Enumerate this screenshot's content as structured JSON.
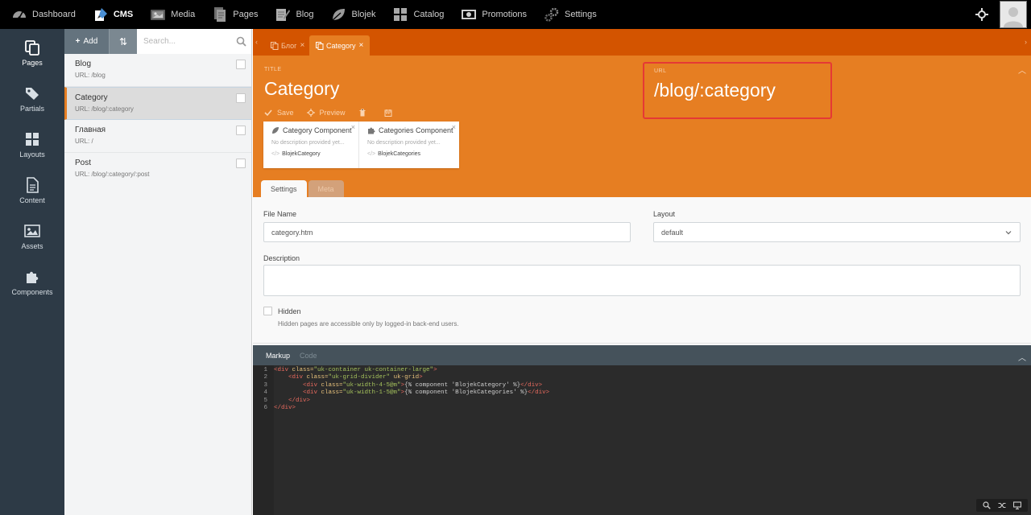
{
  "topnav": {
    "items": [
      {
        "label": "Dashboard",
        "icon": "dashboard-icon",
        "active": false
      },
      {
        "label": "CMS",
        "icon": "cms-icon",
        "active": true
      },
      {
        "label": "Media",
        "icon": "media-icon",
        "active": false
      },
      {
        "label": "Pages",
        "icon": "pages-icon",
        "active": false
      },
      {
        "label": "Blog",
        "icon": "blog-icon",
        "active": false
      },
      {
        "label": "Blojek",
        "icon": "blojek-leaf-icon",
        "active": false
      },
      {
        "label": "Catalog",
        "icon": "catalog-icon",
        "active": false
      },
      {
        "label": "Promotions",
        "icon": "promotions-icon",
        "active": false
      },
      {
        "label": "Settings",
        "icon": "settings-icon",
        "active": false
      }
    ]
  },
  "sidenav": {
    "items": [
      {
        "label": "Pages",
        "icon": "pages-icon",
        "active": true
      },
      {
        "label": "Partials",
        "icon": "tags-icon",
        "active": false
      },
      {
        "label": "Layouts",
        "icon": "layouts-icon",
        "active": false
      },
      {
        "label": "Content",
        "icon": "content-file-icon",
        "active": false
      },
      {
        "label": "Assets",
        "icon": "image-icon",
        "active": false
      },
      {
        "label": "Components",
        "icon": "puzzle-icon",
        "active": false
      }
    ]
  },
  "list": {
    "add_label": "Add",
    "sort_symbol": "⇅",
    "search_placeholder": "Search...",
    "items": [
      {
        "title": "Blog",
        "url": "URL: /blog",
        "selected": false
      },
      {
        "title": "Category",
        "url": "URL: /blog/:category",
        "selected": true
      },
      {
        "title": "Главная",
        "url": "URL: /",
        "selected": false
      },
      {
        "title": "Post",
        "url": "URL: /blog/:category/:post",
        "selected": false
      }
    ]
  },
  "editor": {
    "tabs": [
      {
        "label": "Блог",
        "active": false
      },
      {
        "label": "Category",
        "active": true
      }
    ],
    "title_label": "TITLE",
    "title": "Category",
    "url_label": "URL",
    "url": "/blog/:category",
    "actions": {
      "save": "Save",
      "preview": "Preview"
    },
    "components": [
      {
        "name": "Category Component",
        "desc": "No description provided yet...",
        "alias": "BlojekCategory",
        "icon": "leaf-icon"
      },
      {
        "name": "Categories Component",
        "desc": "No description provided yet...",
        "alias": "BlojekCategories",
        "icon": "puzzle-icon"
      }
    ],
    "subtabs": [
      {
        "label": "Settings",
        "active": true
      },
      {
        "label": "Meta",
        "active": false
      }
    ],
    "settings": {
      "file_name_label": "File Name",
      "file_name": "category.htm",
      "layout_label": "Layout",
      "layout": "default",
      "description_label": "Description",
      "description": "",
      "hidden_label": "Hidden",
      "hidden_help": "Hidden pages are accessible only by logged-in back-end users."
    },
    "code_tabs": [
      {
        "label": "Markup",
        "active": true
      },
      {
        "label": "Code",
        "active": false
      }
    ],
    "code_line_numbers": [
      "1",
      "2",
      "3",
      "4",
      "5",
      "6"
    ],
    "code": {
      "l1_open": "<div",
      "l1_attr": " class=",
      "l1_str": "\"uk-container uk-container-large\"",
      "l1_close": ">",
      "l2_indent": "    ",
      "l2_open": "<div",
      "l2_attr": " class=",
      "l2_str": "\"uk-grid-divider\"",
      "l2_attr2": " uk-grid",
      "l2_close": ">",
      "l3_indent": "        ",
      "l3_open": "<div",
      "l3_attr": " class=",
      "l3_str": "\"uk-width-4-5@m\"",
      "l3_gt": ">",
      "l3_tw": "{% component 'BlojekCategory' %}",
      "l3_end": "</div>",
      "l4_indent": "        ",
      "l4_open": "<div",
      "l4_attr": " class=",
      "l4_str": "\"uk-width-1-5@m\"",
      "l4_gt": ">",
      "l4_tw": "{% component 'BlojekCategories' %}",
      "l4_end": "</div>",
      "l5_indent": "    ",
      "l5_end": "</div>",
      "l6_end": "</div>"
    }
  },
  "colors": {
    "accent": "#e67e22",
    "tabstrip": "#d35400",
    "sidebar": "#2d3a46",
    "url_highlight": "#e53935"
  }
}
